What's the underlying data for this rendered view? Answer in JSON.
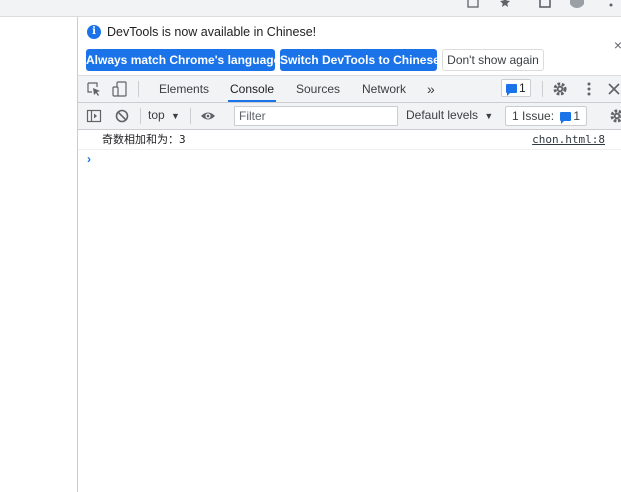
{
  "infobar": {
    "message": "DevTools is now available in Chinese!",
    "btn_match_language": "Always match Chrome's language",
    "btn_switch_chinese": "Switch DevTools to Chinese",
    "btn_dont_show": "Don't show again",
    "close_glyph": "×"
  },
  "tabs": {
    "items": [
      "Elements",
      "Console",
      "Sources",
      "Network"
    ],
    "active": "Console",
    "more_glyph": "»",
    "messages_count": "1"
  },
  "console_toolbar": {
    "context": "top",
    "filter_placeholder": "Filter",
    "levels": "Default levels",
    "issues_label": "1 Issue:",
    "issues_count": "1"
  },
  "console": {
    "log_message": "奇数相加和为：3",
    "log_source": "chon.html:8",
    "prompt_glyph": "›"
  },
  "colors": {
    "accent": "#1a73e8",
    "toolbar_bg": "#f1f3f4",
    "border": "#cbcdd1"
  },
  "icons": [
    "info-icon",
    "inspect-icon",
    "device-toolbar-icon",
    "settings-icon",
    "kebab-menu-icon",
    "close-icon",
    "sidebar-toggle-icon",
    "clear-console-icon",
    "eye-icon",
    "message-icon"
  ]
}
